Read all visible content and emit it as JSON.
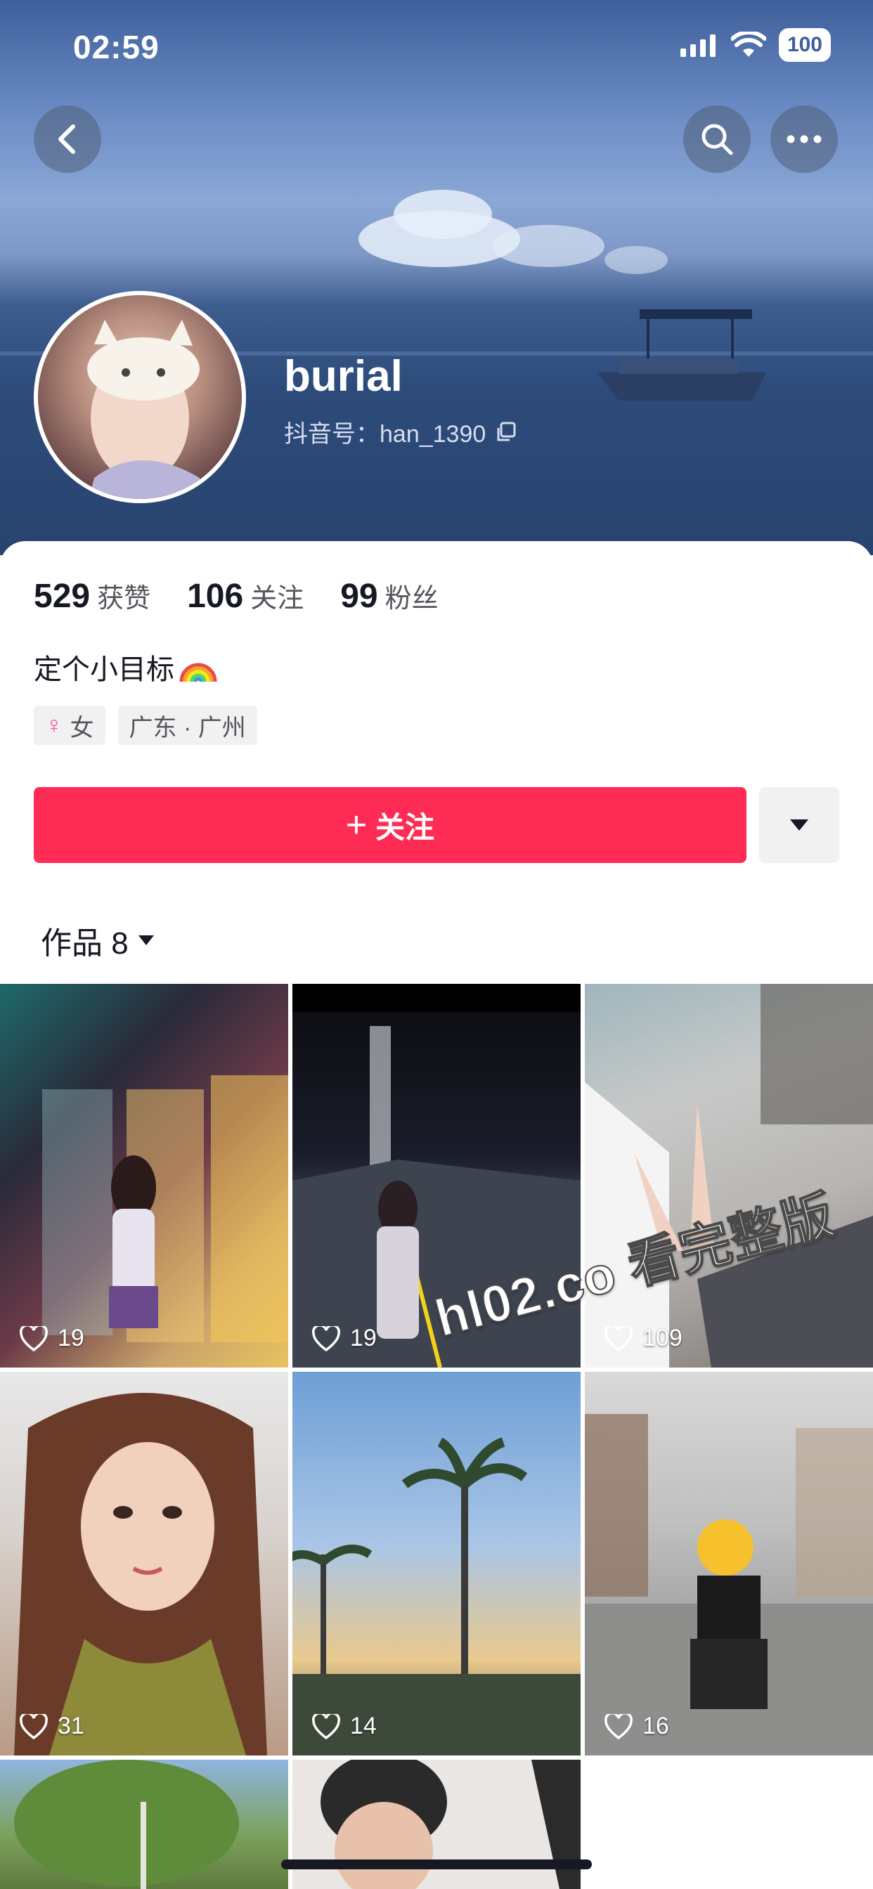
{
  "status_bar": {
    "time": "02:59",
    "battery": "100"
  },
  "profile": {
    "username": "burial",
    "douyin_id": "抖音号：han_1390",
    "stats": [
      {
        "value": "529",
        "label": "获赞"
      },
      {
        "value": "106",
        "label": "关注"
      },
      {
        "value": "99",
        "label": "粉丝"
      }
    ],
    "bio": "定个小目标",
    "tags": {
      "gender_symbol": "♀",
      "gender": "女",
      "location": "广东 · 广州"
    }
  },
  "actions": {
    "follow_label": "关注",
    "follow_icon": "+"
  },
  "works_tab": {
    "label": "作品 8"
  },
  "videos": [
    {
      "likes": "19"
    },
    {
      "likes": "19"
    },
    {
      "likes": "109"
    },
    {
      "likes": "31"
    },
    {
      "likes": "14"
    },
    {
      "likes": "16"
    }
  ],
  "watermark": "hl02.co 看完整版",
  "colors": {
    "accent": "#fe2c55",
    "text": "#161823",
    "muted": "#55565d",
    "chip_bg": "#f1f1f2"
  },
  "icons": [
    "back-icon",
    "search-icon",
    "more-icon",
    "copy-icon",
    "female-icon",
    "dropdown-icon",
    "heart-icon",
    "rainbow-emoji"
  ]
}
